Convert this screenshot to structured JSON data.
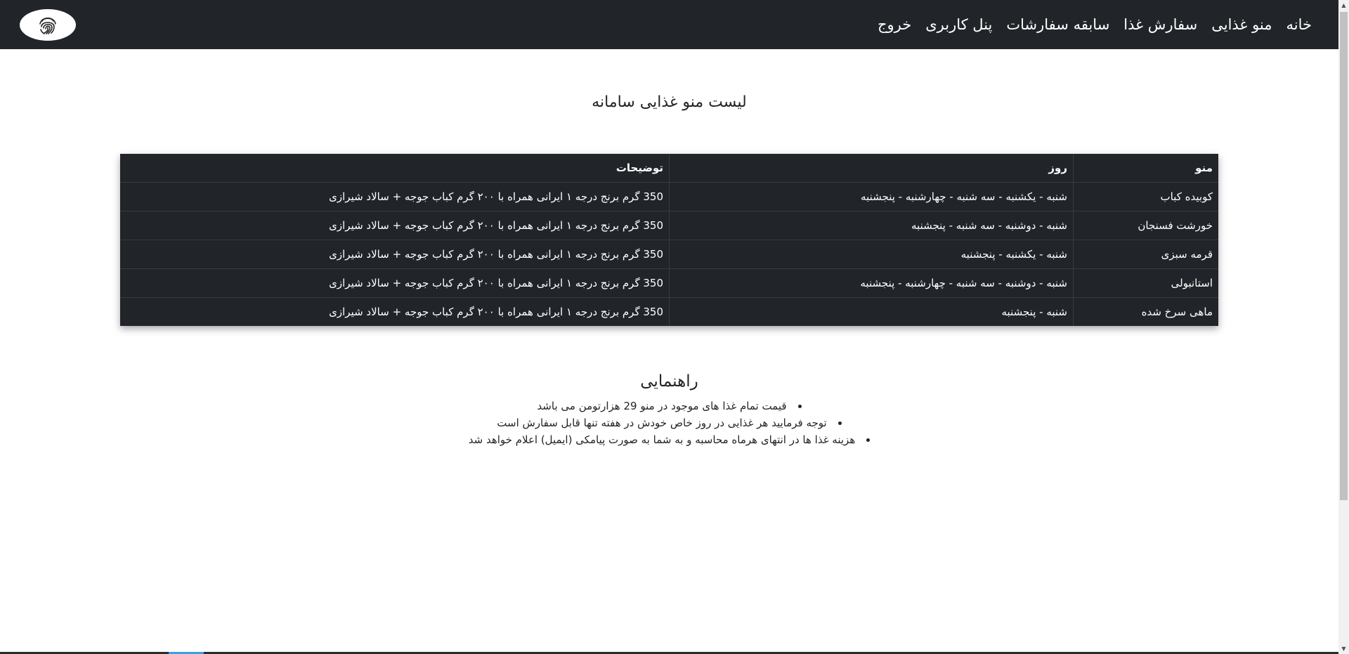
{
  "nav": {
    "items": [
      {
        "label": "خانه"
      },
      {
        "label": "منو غذایی"
      },
      {
        "label": "سفارش غذا"
      },
      {
        "label": "سابقه سفارشات"
      },
      {
        "label": "پنل کاربری"
      },
      {
        "label": "خروج"
      }
    ],
    "logo_icon": "fingerprint-icon"
  },
  "page_title": "لیست منو غذایی سامانه",
  "table": {
    "headers": {
      "menu": "منو",
      "day": "روز",
      "description": "توضیحات"
    },
    "rows": [
      {
        "menu": "کوبیده کباب",
        "day": "شنبه - یکشنبه - سه شنبه - چهارشنبه - پنجشنبه",
        "description": "350 گرم برنج درجه ۱ ایرانی همراه با ۲۰۰ گرم کباب جوجه + سالاد شیرازی"
      },
      {
        "menu": "خورشت فسنجان",
        "day": "شنبه - دوشنبه - سه شنبه - پنجشنبه",
        "description": "350 گرم برنج درجه ۱ ایرانی همراه با ۲۰۰ گرم کباب جوجه + سالاد شیرازی"
      },
      {
        "menu": "قرمه سبزی",
        "day": "شنبه - یکشنبه - پنجشنبه",
        "description": "350 گرم برنج درجه ۱ ایرانی همراه با ۲۰۰ گرم کباب جوجه + سالاد شیرازی"
      },
      {
        "menu": "استانبولی",
        "day": "شنبه - دوشنبه - سه شنبه - چهارشنبه - پنجشنبه",
        "description": "350 گرم برنج درجه ۱ ایرانی همراه با ۲۰۰ گرم کباب جوجه + سالاد شیرازی"
      },
      {
        "menu": "ماهی سرخ شده",
        "day": "شنبه - پنجشنبه",
        "description": "350 گرم برنج درجه ۱ ایرانی همراه با ۲۰۰ گرم کباب جوجه + سالاد شیرازی"
      }
    ]
  },
  "guide": {
    "title": "راهنمایی",
    "items": [
      "قیمت تمام غذا های موجود در منو 29 هزارتومن می باشد",
      "توجه فرمایید هر غذایی در روز خاص خودش در هفته تنها قابل سفارش است",
      "هزینه غذا ها در انتهای هرماه محاسبه و به شما به صورت پیامکی (ایمیل) اعلام خواهد شد"
    ]
  },
  "colors": {
    "navbar_bg": "#212529",
    "table_bg": "#212529",
    "text_light": "#ffffff",
    "text_dark": "#212529"
  }
}
